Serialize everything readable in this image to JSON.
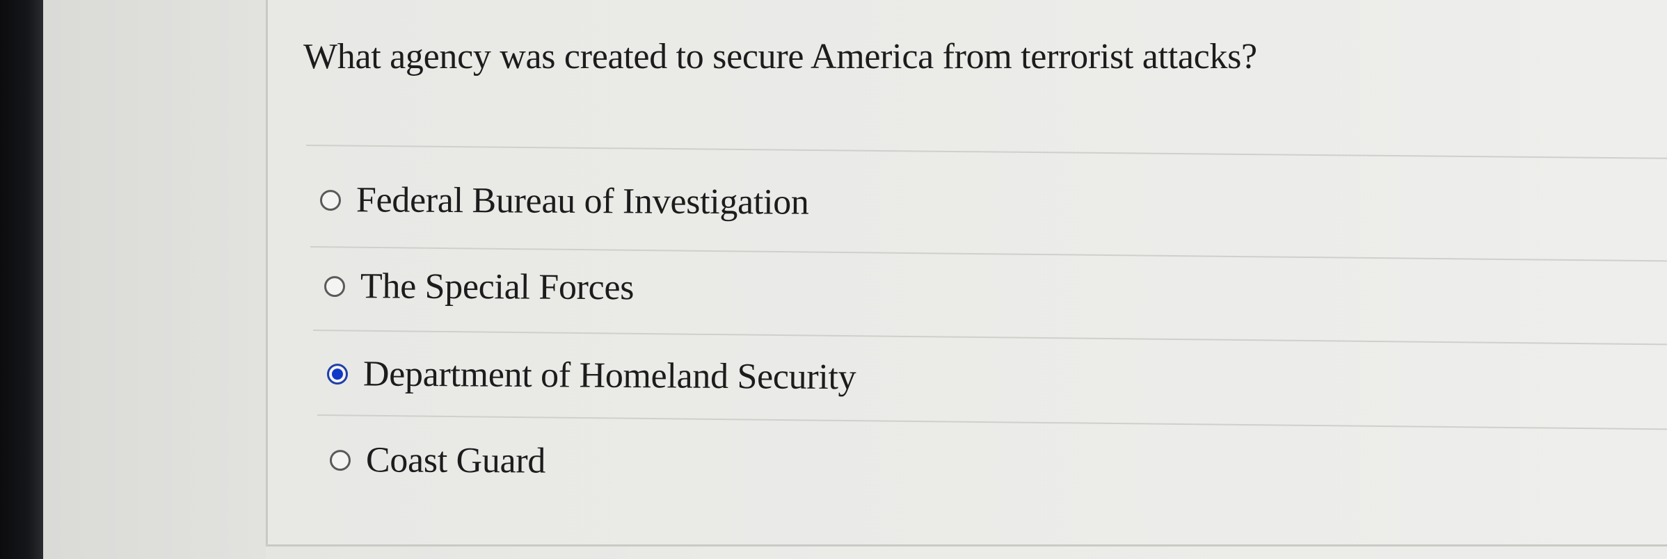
{
  "question": {
    "text": "What agency was created to secure America from terrorist attacks?"
  },
  "options": [
    {
      "label": "Federal Bureau of Investigation",
      "selected": false
    },
    {
      "label": "The Special Forces",
      "selected": false
    },
    {
      "label": "Department of Homeland Security",
      "selected": true
    },
    {
      "label": "Coast Guard",
      "selected": false
    }
  ],
  "colors": {
    "selected_radio": "#1238c9",
    "text": "#1c1c1c",
    "background": "#ebebe8"
  }
}
